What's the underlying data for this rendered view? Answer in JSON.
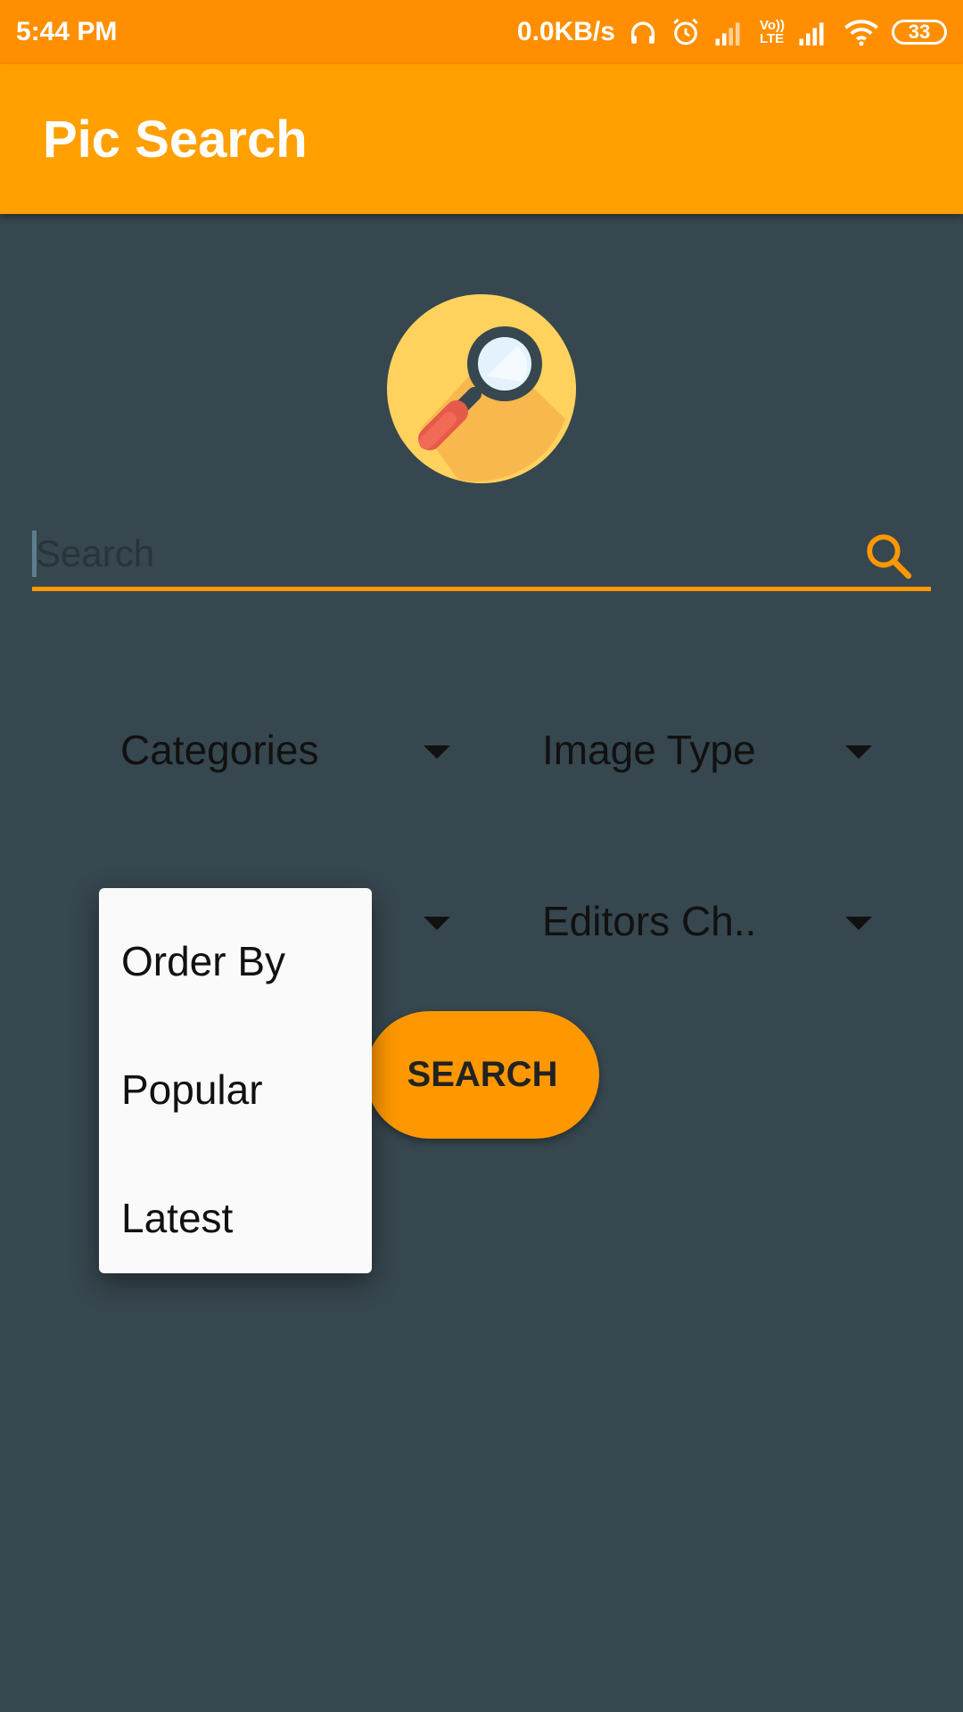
{
  "status_bar": {
    "time": "5:44 PM",
    "network_speed": "0.0KB/s",
    "battery": "33",
    "lte_top": "Vo))",
    "lte_bottom": "LTE",
    "icons": [
      "headphones-icon",
      "alarm-icon",
      "signal-icon",
      "volte-icon",
      "signal-icon",
      "wifi-icon",
      "battery-icon"
    ]
  },
  "app_bar": {
    "title": "Pic Search"
  },
  "search": {
    "placeholder": "Search",
    "value": ""
  },
  "filters": {
    "categories": "Categories",
    "image_type": "Image Type",
    "editors_choice": "Editors Ch.."
  },
  "search_button": {
    "label": "SEARCH"
  },
  "order_menu": {
    "items": [
      "Order By",
      "Popular",
      "Latest"
    ]
  },
  "colors": {
    "status_bar": "#ff8f00",
    "app_bar": "#ffa000",
    "background": "#37474f",
    "accent": "#ff9800",
    "menu_background": "#fafafa"
  }
}
